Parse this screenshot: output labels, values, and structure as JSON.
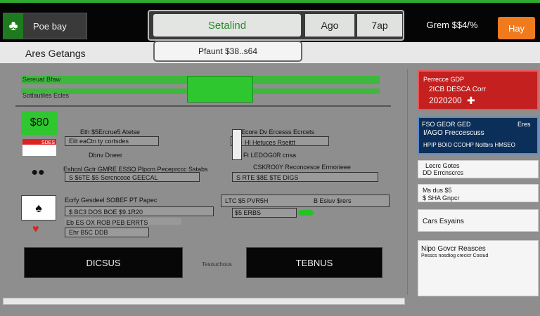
{
  "topbar": {
    "brand_label": "Poe bay",
    "tabs": [
      {
        "label": "Setalind"
      },
      {
        "label": "Ago"
      },
      {
        "label": "7ap"
      }
    ],
    "balance": "Grem $$4/%",
    "action_button": "Hay"
  },
  "subbar": {
    "page_title": "Ares Getangs",
    "search_value": "Pfaunt $38..s64"
  },
  "main": {
    "header_rows": [
      "Sereuat Bfaw",
      "Sotlautiles  Ecles"
    ],
    "odds_badge": "$80",
    "red_flag_text": "SDES",
    "rows": [
      {
        "left": "Eth  $5Ercrue5 Atetse",
        "left_field": "Elit eaCtn ty cortsdes",
        "right": "F$  Ecore Dv Ercesss Ecrcets",
        "right_field": "Hl  Hetuces Rseittt"
      },
      {
        "left": "Dbnv Dneer",
        "left_field": "",
        "right": "Ft  LEDOG0R cnsa",
        "right_field": ""
      },
      {
        "left": "Eshcnl Gctr GMRE ESSQ Plpcm Peceprccc Sstabs",
        "left_field": "S  $6TE $5 Sercncose GEECAL",
        "right": "CSKRO0Y  Reconcesce Ermorieee",
        "right_field": "S   RTE $8E $TE DIGS"
      },
      {
        "left": "Ecrfy Gesdeel SOBEF PT Papec",
        "left_field": "$  BC3  DOS  BOE $9.1R20",
        "right": "LTC $5 PVR5H",
        "right_field": "B   Esiuv  $rers",
        "right_extra": "$5  ERBS"
      },
      {
        "left": "Eb  ES  OX  ROB  PEB  ERRTS",
        "left_field": "Ehr  B5C  DDB",
        "right": "",
        "right_field": ""
      }
    ],
    "button_left": "DICSUS",
    "button_mid_text": "Tesouchous",
    "button_right": "TEBNUS"
  },
  "right_panel": {
    "red_card": {
      "line1": "Perrecce GDP",
      "line2": "2ICB DESCA Corr",
      "line3": "2020200"
    },
    "blue_card": {
      "line1": "FSO  GEOR  GED",
      "line2": "I/AGO  Freccescuss",
      "line3": "HPIP  BOIO  CCOHP  Noltbrs  HMSEO",
      "tag": "Eres"
    },
    "item1": {
      "line1": "Lecrc Gotes",
      "line2": "DD  Errcnscrcs"
    },
    "item2": {
      "line1": "Ms dus $5",
      "line2": "$  SHA Gnpcr"
    },
    "item3": {
      "line1": "Cars Esyains"
    },
    "item4": {
      "line1": "Nipo Govcr  Reasces",
      "line2": "Pesscs nosdiog crecicr Cosiud"
    }
  },
  "colors": {
    "accent_green": "#2fc72f",
    "alert_red": "#c42020",
    "navy": "#0c2f5a",
    "orange": "#f07a1e"
  },
  "icons": [
    "clover-icon",
    "spade-icon",
    "heart-icon",
    "flag-icon",
    "plus-icon"
  ]
}
